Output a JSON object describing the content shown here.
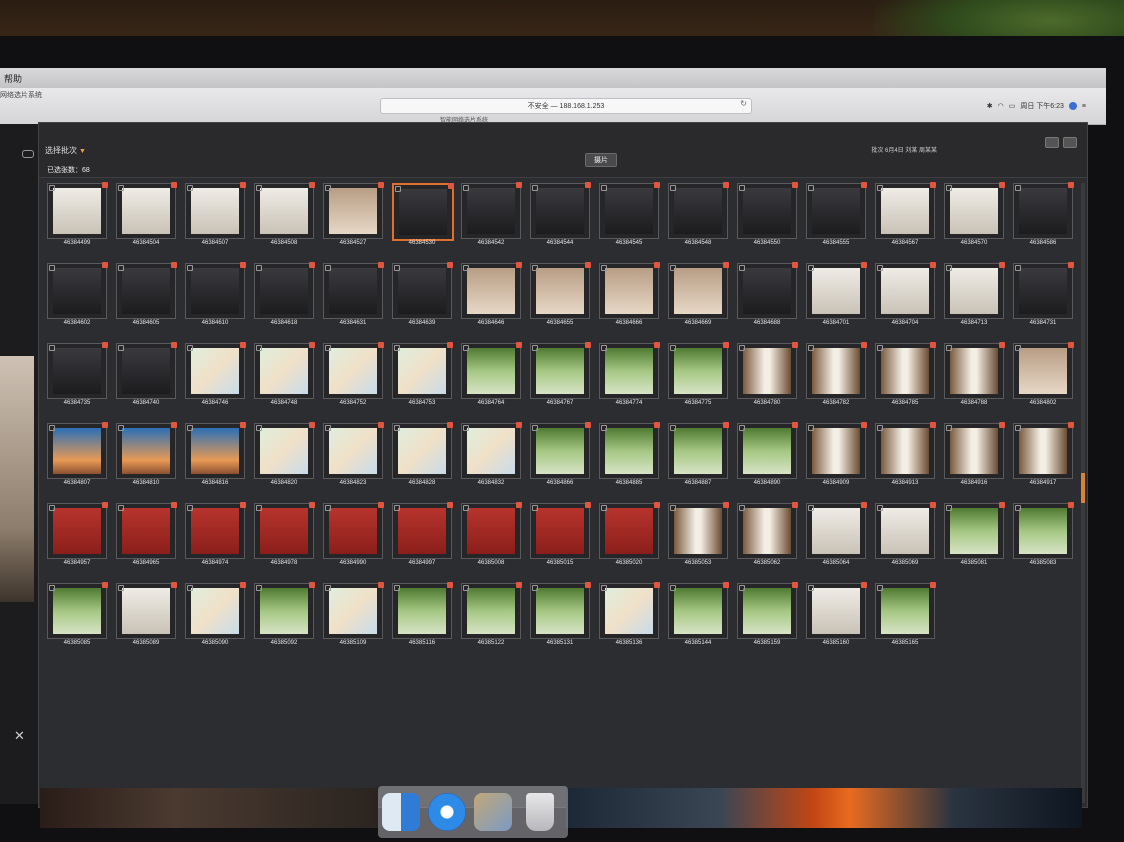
{
  "menubar": {
    "help": "帮助"
  },
  "browser": {
    "site_title": "网络选片系统",
    "url": "不安全 — 188.168.1.253",
    "tab_title": "智能网络选片系统",
    "clock": "周日 下午6:23"
  },
  "app": {
    "batch_select_label": "选择批次",
    "selected_count_label": "已选张数：68",
    "filter_chip": "摄片",
    "crumb": "批次 6月4日 刘某 周某某"
  },
  "colors": {
    "accent": "#e0702e",
    "badge": "#e2553e",
    "window_bg": "#2c2d30"
  },
  "photos": [
    {
      "code": "46384499",
      "tone": "light"
    },
    {
      "code": "46384504",
      "tone": "light"
    },
    {
      "code": "46384507",
      "tone": "light"
    },
    {
      "code": "46384508",
      "tone": "light"
    },
    {
      "code": "46384527",
      "tone": "warm"
    },
    {
      "code": "46384530",
      "tone": "dark",
      "active": true
    },
    {
      "code": "46384542",
      "tone": "dark"
    },
    {
      "code": "46384544",
      "tone": "dark"
    },
    {
      "code": "46384545",
      "tone": "dark"
    },
    {
      "code": "46384548",
      "tone": "dark"
    },
    {
      "code": "46384550",
      "tone": "dark"
    },
    {
      "code": "46384555",
      "tone": "dark"
    },
    {
      "code": "46384567",
      "tone": "light"
    },
    {
      "code": "46384570",
      "tone": "light"
    },
    {
      "code": "46384586",
      "tone": "dark"
    },
    {
      "code": "46384602",
      "tone": "dark"
    },
    {
      "code": "46384605",
      "tone": "dark"
    },
    {
      "code": "46384610",
      "tone": "dark"
    },
    {
      "code": "46384618",
      "tone": "dark"
    },
    {
      "code": "46384631",
      "tone": "dark"
    },
    {
      "code": "46384639",
      "tone": "dark"
    },
    {
      "code": "46384646",
      "tone": "warm"
    },
    {
      "code": "46384655",
      "tone": "warm"
    },
    {
      "code": "46384666",
      "tone": "warm"
    },
    {
      "code": "46384669",
      "tone": "warm"
    },
    {
      "code": "46384688",
      "tone": "dark"
    },
    {
      "code": "46384701",
      "tone": "light"
    },
    {
      "code": "46384704",
      "tone": "light"
    },
    {
      "code": "46384713",
      "tone": "light"
    },
    {
      "code": "46384731",
      "tone": "dark"
    },
    {
      "code": "46384735",
      "tone": "dark"
    },
    {
      "code": "46384740",
      "tone": "dark"
    },
    {
      "code": "46384746",
      "tone": "pastel"
    },
    {
      "code": "46384748",
      "tone": "pastel"
    },
    {
      "code": "46384752",
      "tone": "pastel"
    },
    {
      "code": "46384753",
      "tone": "pastel"
    },
    {
      "code": "46384764",
      "tone": "green"
    },
    {
      "code": "46384767",
      "tone": "green"
    },
    {
      "code": "46384774",
      "tone": "green"
    },
    {
      "code": "46384775",
      "tone": "green"
    },
    {
      "code": "46384780",
      "tone": "window"
    },
    {
      "code": "46384782",
      "tone": "window"
    },
    {
      "code": "46384785",
      "tone": "window"
    },
    {
      "code": "46384788",
      "tone": "window"
    },
    {
      "code": "46384802",
      "tone": "warm"
    },
    {
      "code": "46384807",
      "tone": "blue"
    },
    {
      "code": "46384810",
      "tone": "blue"
    },
    {
      "code": "46384816",
      "tone": "blue"
    },
    {
      "code": "46384820",
      "tone": "pastel"
    },
    {
      "code": "46384823",
      "tone": "pastel"
    },
    {
      "code": "46384828",
      "tone": "pastel"
    },
    {
      "code": "46384832",
      "tone": "pastel"
    },
    {
      "code": "46384866",
      "tone": "green"
    },
    {
      "code": "46384885",
      "tone": "green"
    },
    {
      "code": "46384887",
      "tone": "green"
    },
    {
      "code": "46384890",
      "tone": "green"
    },
    {
      "code": "46384909",
      "tone": "window"
    },
    {
      "code": "46384913",
      "tone": "window"
    },
    {
      "code": "46384916",
      "tone": "window"
    },
    {
      "code": "46384917",
      "tone": "window"
    },
    {
      "code": "46384957",
      "tone": "red"
    },
    {
      "code": "46384965",
      "tone": "red"
    },
    {
      "code": "46384974",
      "tone": "red"
    },
    {
      "code": "46384978",
      "tone": "red"
    },
    {
      "code": "46384990",
      "tone": "red"
    },
    {
      "code": "46384997",
      "tone": "red"
    },
    {
      "code": "46385008",
      "tone": "red"
    },
    {
      "code": "46385015",
      "tone": "red"
    },
    {
      "code": "46385020",
      "tone": "red"
    },
    {
      "code": "46385053",
      "tone": "window"
    },
    {
      "code": "46385062",
      "tone": "window"
    },
    {
      "code": "46385064",
      "tone": "light"
    },
    {
      "code": "46385069",
      "tone": "light"
    },
    {
      "code": "46385081",
      "tone": "green"
    },
    {
      "code": "46385083",
      "tone": "green"
    },
    {
      "code": "46385085",
      "tone": "green"
    },
    {
      "code": "46385089",
      "tone": "light"
    },
    {
      "code": "46385090",
      "tone": "pastel"
    },
    {
      "code": "46385092",
      "tone": "green"
    },
    {
      "code": "46385109",
      "tone": "pastel"
    },
    {
      "code": "46385116",
      "tone": "green"
    },
    {
      "code": "46385122",
      "tone": "green"
    },
    {
      "code": "46385131",
      "tone": "green"
    },
    {
      "code": "46385136",
      "tone": "pastel"
    },
    {
      "code": "46385144",
      "tone": "green"
    },
    {
      "code": "46385159",
      "tone": "green"
    },
    {
      "code": "46385160",
      "tone": "light"
    },
    {
      "code": "46385165",
      "tone": "green"
    }
  ],
  "dock": [
    "finder-icon",
    "safari-icon",
    "photos-icon",
    "trash-icon"
  ]
}
